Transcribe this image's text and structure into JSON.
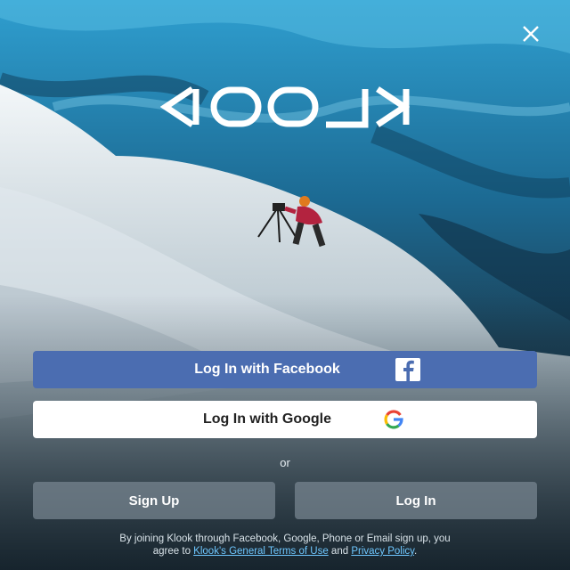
{
  "header": {
    "close_icon": "close-icon",
    "brand": "KLOOK"
  },
  "auth": {
    "facebook_label": "Log In with Facebook",
    "facebook_icon": "facebook-icon",
    "google_label": "Log In with Google",
    "google_icon": "google-icon",
    "or_label": "or",
    "login_label": "Log In",
    "signup_label": "Sign Up"
  },
  "legal": {
    "line1": "By joining Klook through Facebook, Google, Phone or Email sign up, you",
    "line2_prefix": "agree to",
    "terms_link": "Klook's General Terms of Use",
    "and": "and",
    "privacy_link": "Privacy Policy",
    "period": "."
  },
  "colors": {
    "facebook": "#4b6db1",
    "google_button": "#ffffff",
    "secondary_button": "#78878f",
    "link": "#6ec7ff"
  }
}
